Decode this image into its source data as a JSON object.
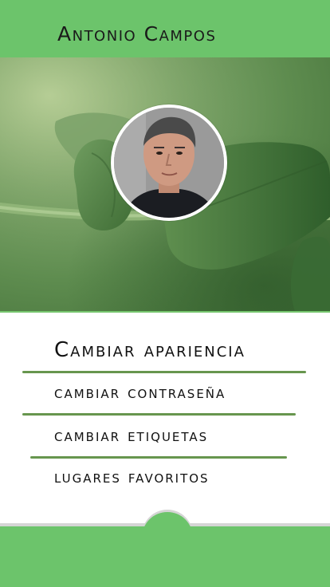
{
  "header": {
    "title": "Antonio Campos"
  },
  "profile": {
    "avatar_icon": "user-avatar-photo"
  },
  "menu": {
    "items": [
      {
        "label": "Cambiar apariencia"
      },
      {
        "label": "cambiar contraseña"
      },
      {
        "label": "cambiar etiquetas"
      },
      {
        "label": "lugares favoritos"
      }
    ]
  },
  "colors": {
    "primary": "#6cc46b",
    "divider": "#5f9045",
    "text": "#111111"
  }
}
